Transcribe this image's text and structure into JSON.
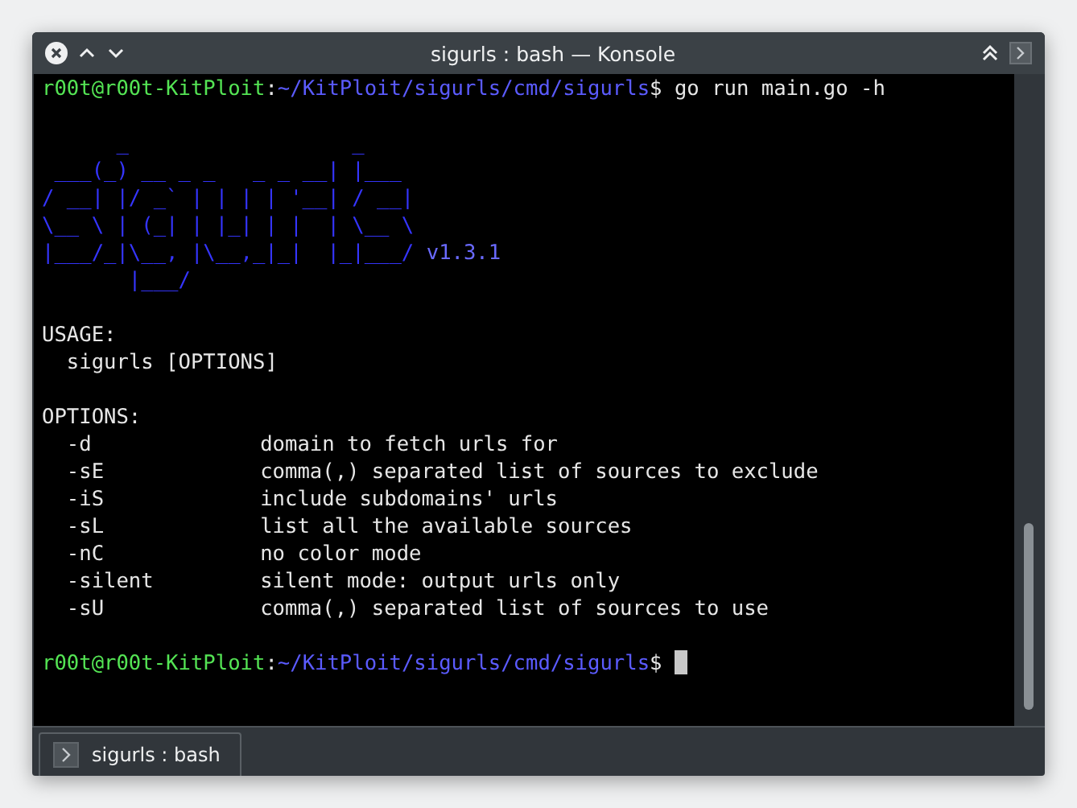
{
  "window": {
    "title": "sigurls : bash — Konsole"
  },
  "terminal": {
    "first_prompt": {
      "user": "r00t@r00t-KitPloit",
      "separator": ":",
      "path": "~/KitPloit/sigurls/cmd/sigurls",
      "symbol": "$",
      "command": "go run main.go -h"
    },
    "banner": [
      {
        "art": "      _                  _"
      },
      {
        "art": " ___(_) __ _ _   _ _ __| |___"
      },
      {
        "art": "/ __| |/ _` | | | | '__| / __|"
      },
      {
        "art": "\\__ \\ | (_| | |_| | |  | \\__ \\"
      },
      {
        "art": "|___/_|\\__, |\\__,_|_|  |_|___/",
        "version": "v1.3.1"
      },
      {
        "art": "       |___/"
      }
    ],
    "usage_heading": "USAGE:",
    "usage": "sigurls [OPTIONS]",
    "options_heading": "OPTIONS:",
    "options": [
      {
        "flag": "-d",
        "description": "domain to fetch urls for"
      },
      {
        "flag": "-sE",
        "description": "comma(,) separated list of sources to exclude"
      },
      {
        "flag": "-iS",
        "description": "include subdomains' urls"
      },
      {
        "flag": "-sL",
        "description": "list all the available sources"
      },
      {
        "flag": "-nC",
        "description": "no color mode"
      },
      {
        "flag": "-silent",
        "description": "silent mode: output urls only"
      },
      {
        "flag": "-sU",
        "description": "comma(,) separated list of sources to use"
      }
    ],
    "last_prompt": {
      "user": "r00t@r00t-KitPloit",
      "separator": ":",
      "path": "~/KitPloit/sigurls/cmd/sigurls",
      "symbol": "$"
    }
  },
  "tabs": [
    {
      "label": "sigurls : bash",
      "selected": true
    }
  ]
}
